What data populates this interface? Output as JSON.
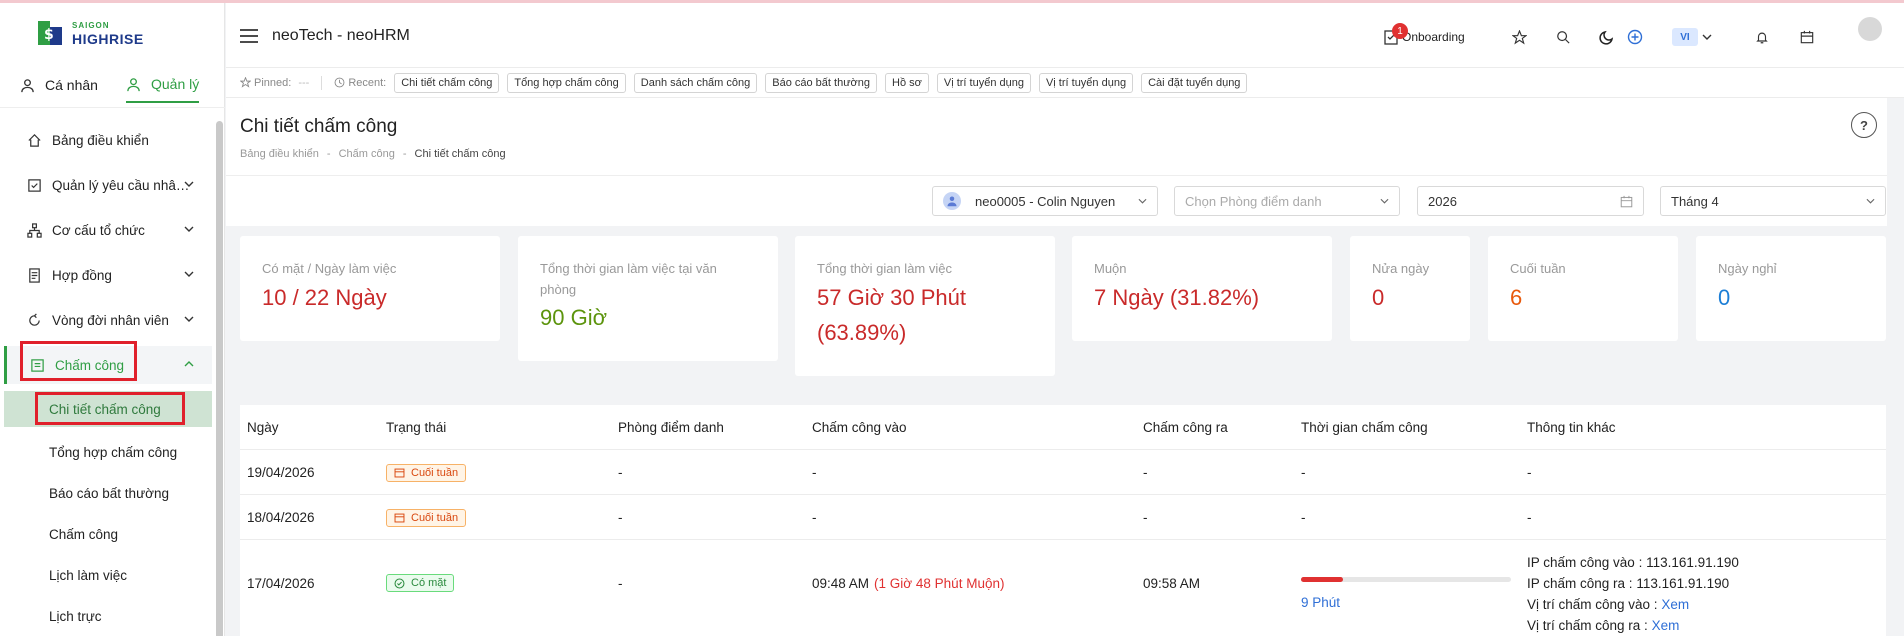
{
  "brand": {
    "line1": "SAIGON",
    "line2": "HIGHRISE"
  },
  "header": {
    "menu_icon": "hamburger-icon",
    "title": "neoTech - neoHRM",
    "onboarding_label": "Onboarding",
    "onboarding_count": "1",
    "lang": "VI"
  },
  "side_tabs": [
    {
      "label": "Cá nhân",
      "icon": "user-icon"
    },
    {
      "label": "Quản lý",
      "icon": "user-icon"
    }
  ],
  "menu": [
    {
      "label": "Bảng điều khiển",
      "icon": "home-icon"
    },
    {
      "label": "Quản lý yêu cầu nhân viên",
      "icon": "checkbox-icon"
    },
    {
      "label": "Cơ cấu tổ chức",
      "icon": "org-icon"
    },
    {
      "label": "Hợp đồng",
      "icon": "contract-icon"
    },
    {
      "label": "Vòng đời nhân viên",
      "icon": "cycle-icon"
    },
    {
      "label": "Chấm công",
      "icon": "timesheet-icon"
    }
  ],
  "submenu": [
    "Chi tiết chấm công",
    "Tổng hợp chấm công",
    "Báo cáo bất thường",
    "Chấm công",
    "Lịch làm việc",
    "Lịch trực"
  ],
  "pinbar": {
    "pinned_label": "Pinned:",
    "pinned_value": "---",
    "recent_label": "Recent:",
    "chips": [
      "Chi tiết chấm công",
      "Tổng hợp chấm công",
      "Danh sách chấm công",
      "Báo cáo bất thường",
      "Hồ sơ",
      "Vị trí tuyển dụng",
      "Vị trí tuyển dụng",
      "Cài đặt tuyển dụng"
    ]
  },
  "page": {
    "title": "Chi tiết chấm công",
    "breadcrumb": [
      "Bảng điều khiển",
      "Chấm công",
      "Chi tiết chấm công"
    ],
    "crumb_sep": "-",
    "help": "?"
  },
  "filters": {
    "employee": "neo0005 - Colin Nguyen",
    "room_placeholder": "Chọn Phòng điểm danh",
    "year": "2026",
    "month": "Tháng 4"
  },
  "stats": [
    {
      "label": "Có mặt / Ngày làm việc",
      "value": "10 / 22 Ngày",
      "color": "#c92a2a"
    },
    {
      "label": "Tổng thời gian làm việc tại văn phòng",
      "value": "90 Giờ",
      "color": "#5c940d"
    },
    {
      "label": "Tổng thời gian làm việc",
      "value": "57 Giờ 30 Phút (63.89%)",
      "color": "#c92a2a"
    },
    {
      "label": "Muộn",
      "value": "7 Ngày (31.82%)",
      "color": "#c92a2a"
    },
    {
      "label": "Nửa ngày",
      "value": "0",
      "color": "#c92a2a"
    },
    {
      "label": "Cuối tuần",
      "value": "6",
      "color": "#e8590c"
    },
    {
      "label": "Ngày nghỉ",
      "value": "0",
      "color": "#1c7ed6"
    }
  ],
  "table": {
    "columns": [
      "Ngày",
      "Trạng thái",
      "Phòng điểm danh",
      "Chấm công vào",
      "Chấm công ra",
      "Thời gian chấm công",
      "Thông tin khác"
    ],
    "rows": [
      {
        "date": "19/04/2026",
        "status": "Cuối tuần",
        "room": "-",
        "in": "-",
        "out": "-",
        "duration": "-",
        "other": "-"
      },
      {
        "date": "18/04/2026",
        "status": "Cuối tuần",
        "room": "-",
        "in": "-",
        "out": "-",
        "duration": "-",
        "other": "-"
      },
      {
        "date": "17/04/2026",
        "status": "Có mặt",
        "room": "-",
        "in": "09:48 AM",
        "in_late": "(1 Giờ 48 Phút Muộn)",
        "out": "09:58 AM",
        "duration": "9 Phút",
        "progress_fraction": 0.2,
        "ip_in_label": "IP chấm công vào :",
        "ip_in": "113.161.91.190",
        "ip_out_label": "IP chấm công ra :",
        "ip_out": "113.161.91.190",
        "loc_in_label": "Vị trí chấm công vào :",
        "loc_out_label": "Vị trí chấm công ra :",
        "view": "Xem"
      }
    ]
  }
}
